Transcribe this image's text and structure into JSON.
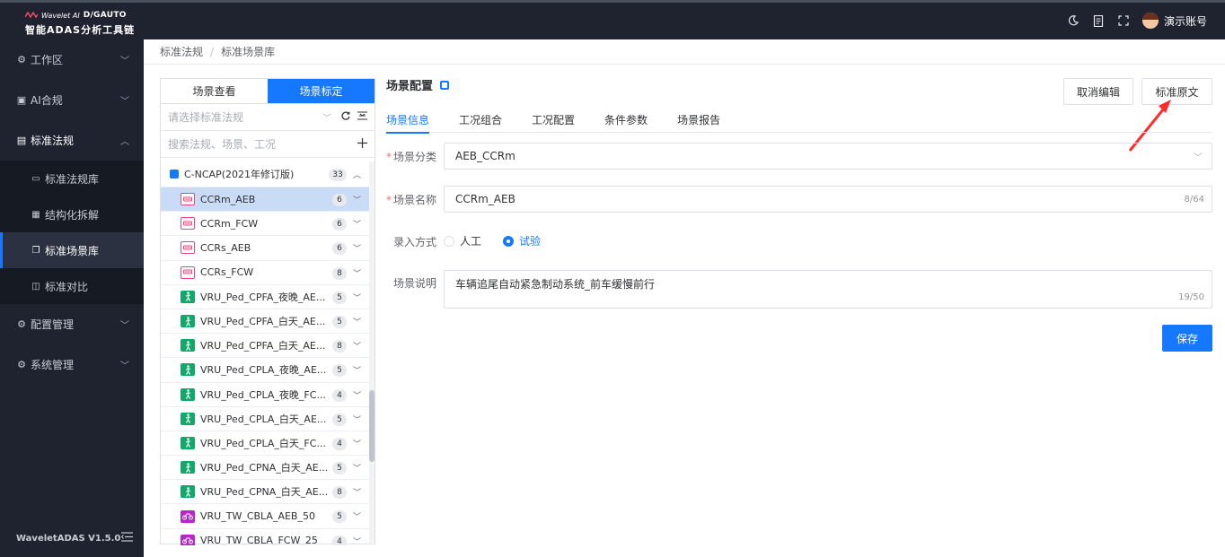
{
  "brand": {
    "wavelet": "Wavelet AI",
    "dgauto": "D/GAUTO",
    "subtitle": "智能ADAS分析工具链"
  },
  "topbar": {
    "icons": [
      "moon-icon",
      "document-icon",
      "fullscreen-icon"
    ],
    "user_name": "演示账号"
  },
  "sidebar": {
    "items": [
      {
        "label": "工作区",
        "icon": "gear-icon"
      },
      {
        "label": "AI合规",
        "icon": "ai-icon"
      },
      {
        "label": "标准法规",
        "icon": "regulation-icon"
      }
    ],
    "submenu": [
      {
        "label": "标准法规库",
        "icon": "book-icon"
      },
      {
        "label": "结构化拆解",
        "icon": "grid-icon"
      },
      {
        "label": "标准场景库",
        "icon": "scene-icon"
      },
      {
        "label": "标准对比",
        "icon": "compare-icon"
      }
    ],
    "bottom_items": [
      {
        "label": "配置管理",
        "icon": "gear-icon"
      },
      {
        "label": "系统管理",
        "icon": "gear-icon"
      }
    ],
    "version": "WaveletADAS  V1.5.0"
  },
  "breadcrumb": {
    "items": [
      "标准法规",
      "标准场景库"
    ],
    "separator": "/"
  },
  "left_panel": {
    "tabs": [
      "场景查看",
      "场景标定"
    ],
    "active_tab": "场景标定",
    "select_placeholder": "请选择标准法规",
    "search_placeholder": "搜索法规、场景、工况",
    "group": {
      "label": "C-NCAP(2021年修订版)",
      "count": "33"
    },
    "items": [
      {
        "label": "CCRm_AEB",
        "count": "6",
        "type": "car"
      },
      {
        "label": "CCRm_FCW",
        "count": "6",
        "type": "car"
      },
      {
        "label": "CCRs_AEB",
        "count": "6",
        "type": "car"
      },
      {
        "label": "CCRs_FCW",
        "count": "8",
        "type": "car"
      },
      {
        "label": "VRU_Ped_CPFA_夜晚_AE...",
        "count": "5",
        "type": "ped"
      },
      {
        "label": "VRU_Ped_CPFA_白天_AE...",
        "count": "5",
        "type": "ped"
      },
      {
        "label": "VRU_Ped_CPFA_白天_AE...",
        "count": "8",
        "type": "ped"
      },
      {
        "label": "VRU_Ped_CPLA_夜晚_AE...",
        "count": "5",
        "type": "ped"
      },
      {
        "label": "VRU_Ped_CPLA_夜晚_FC...",
        "count": "4",
        "type": "ped"
      },
      {
        "label": "VRU_Ped_CPLA_白天_AE...",
        "count": "5",
        "type": "ped"
      },
      {
        "label": "VRU_Ped_CPLA_白天_FC...",
        "count": "4",
        "type": "ped"
      },
      {
        "label": "VRU_Ped_CPNA_白天_AE...",
        "count": "5",
        "type": "ped"
      },
      {
        "label": "VRU_Ped_CPNA_白天_AE...",
        "count": "8",
        "type": "ped"
      },
      {
        "label": "VRU_TW_CBLA_AEB_50",
        "count": "5",
        "type": "bike"
      },
      {
        "label": "VRU_TW_CBLA_FCW_25",
        "count": "4",
        "type": "bike"
      }
    ]
  },
  "config": {
    "title": "场景配置",
    "cancel_button": "取消编辑",
    "original_button": "标准原文",
    "tabs": [
      "场景信息",
      "工况组合",
      "工况配置",
      "条件参数",
      "场景报告"
    ],
    "active_tab": "场景信息",
    "category_label": "场景分类",
    "category_value": "AEB_CCRm",
    "name_label": "场景名称",
    "name_value": "CCRm_AEB",
    "name_counter": "8/64",
    "entry_label": "录入方式",
    "entry_options": [
      "人工",
      "试验"
    ],
    "entry_selected": "试验",
    "desc_label": "场景说明",
    "desc_value": "车辆追尾自动紧急制动系统_前车缓慢前行",
    "desc_counter": "19/50",
    "save_button": "保存"
  },
  "colors": {
    "accent": "#1677ff",
    "sidebar_bg": "#1f2330",
    "annotation_arrow": "#ff2b2b"
  }
}
